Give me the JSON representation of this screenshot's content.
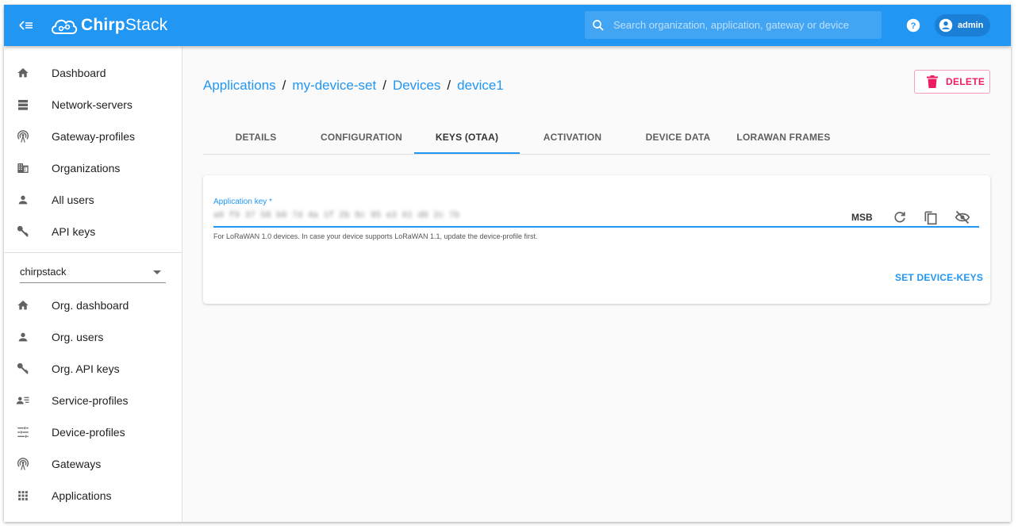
{
  "header": {
    "logo_bold": "Chirp",
    "logo_regular": "Stack",
    "search_placeholder": "Search organization, application, gateway or device",
    "user": "admin",
    "colors": {
      "primary": "#2196f3",
      "delete": "#e91e63"
    }
  },
  "sidebar": {
    "global_items": [
      {
        "label": "Dashboard",
        "icon": "home-icon"
      },
      {
        "label": "Network-servers",
        "icon": "server-icon"
      },
      {
        "label": "Gateway-profiles",
        "icon": "radio-tower-icon"
      },
      {
        "label": "Organizations",
        "icon": "domain-icon"
      },
      {
        "label": "All users",
        "icon": "person-icon"
      },
      {
        "label": "API keys",
        "icon": "key-icon"
      }
    ],
    "org_select": "chirpstack",
    "org_items": [
      {
        "label": "Org. dashboard",
        "icon": "home-icon"
      },
      {
        "label": "Org. users",
        "icon": "person-icon"
      },
      {
        "label": "Org. API keys",
        "icon": "key-icon"
      },
      {
        "label": "Service-profiles",
        "icon": "account-details-icon"
      },
      {
        "label": "Device-profiles",
        "icon": "tune-icon"
      },
      {
        "label": "Gateways",
        "icon": "radio-tower-icon"
      },
      {
        "label": "Applications",
        "icon": "apps-icon"
      }
    ]
  },
  "breadcrumb": {
    "applications": "Applications",
    "app": "my-device-set",
    "devices": "Devices",
    "device": "device1",
    "separator": "/"
  },
  "delete_label": "DELETE",
  "tabs": [
    {
      "label": "DETAILS",
      "active": false
    },
    {
      "label": "CONFIGURATION",
      "active": false
    },
    {
      "label": "KEYS (OTAA)",
      "active": true
    },
    {
      "label": "ACTIVATION",
      "active": false
    },
    {
      "label": "DEVICE DATA",
      "active": false
    },
    {
      "label": "LORAWAN FRAMES",
      "active": false
    }
  ],
  "form": {
    "app_key_label": "Application key *",
    "app_key_value": "a6 f9 37 58 b0 7d 4a 1f 2b 8c 95 e3 61 d0 2c 7b",
    "byte_order": "MSB",
    "helper": "For LoRaWAN 1.0 devices. In case your device supports LoRaWAN 1.1, update the device-profile first.",
    "submit": "SET DEVICE-KEYS"
  }
}
